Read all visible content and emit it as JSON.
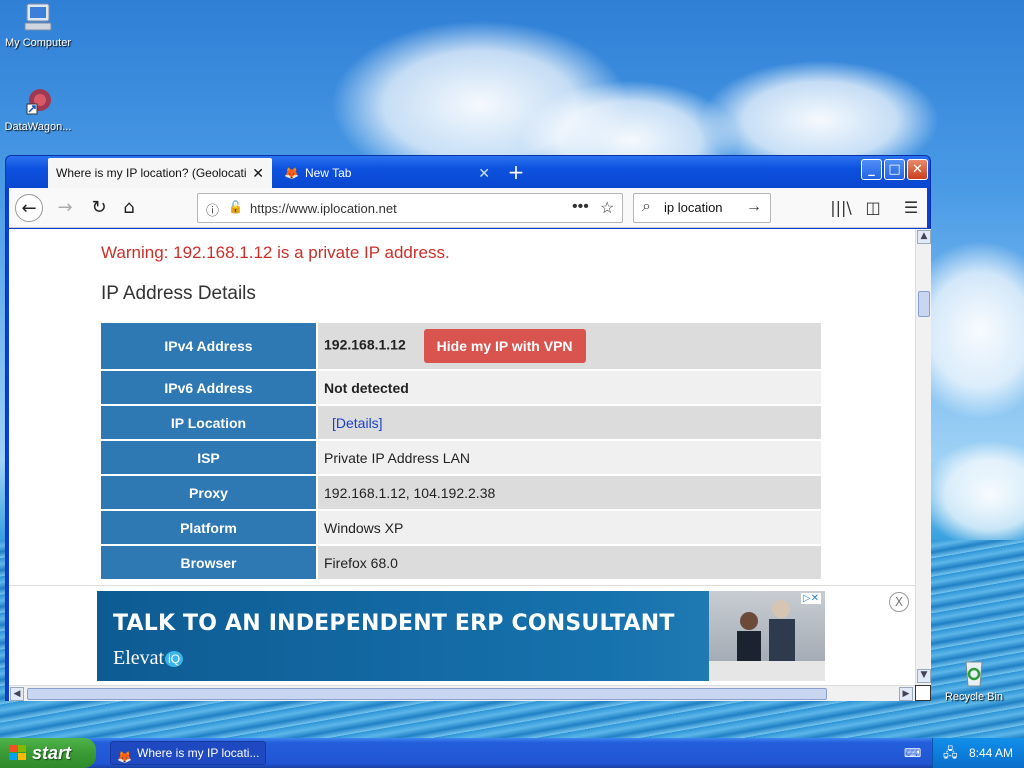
{
  "desktop": {
    "icons": [
      {
        "label": "My Computer"
      },
      {
        "label": "DataWagon..."
      },
      {
        "label": "Recycle Bin"
      }
    ]
  },
  "browser": {
    "tabs": [
      {
        "title": "Where is my IP location? (Geolocation)",
        "active": true
      },
      {
        "title": "New Tab",
        "active": false
      }
    ],
    "new_tab_symbol": "+",
    "url": "https://www.iplocation.net",
    "search_value": "ip location"
  },
  "page": {
    "warning": "Warning: 192.168.1.12 is a private IP address.",
    "section_title": "IP Address Details",
    "rows": [
      {
        "label": "IPv4 Address",
        "value": "192.168.1.12",
        "button": "Hide my IP with VPN"
      },
      {
        "label": "IPv6 Address",
        "value": "Not detected"
      },
      {
        "label": "IP Location",
        "value": "[Details]"
      },
      {
        "label": "ISP",
        "value": "Private IP Address LAN"
      },
      {
        "label": "Proxy",
        "value": "192.168.1.12, 104.192.2.38"
      },
      {
        "label": "Platform",
        "value": "Windows XP"
      },
      {
        "label": "Browser",
        "value": "Firefox 68.0"
      }
    ]
  },
  "ad": {
    "headline": "TALK TO AN INDEPENDENT ERP CONSULTANT",
    "brand": "Elevat",
    "brand_badge": "iQ",
    "close_symbol": "X"
  },
  "taskbar": {
    "start_label": "start",
    "task_title": "Where is my IP locati...",
    "clock": "8:44 AM"
  },
  "colors": {
    "warning": "#cc2f2a",
    "table_header": "#2e78b4",
    "vpn_button": "#d9534f",
    "link": "#1a3fcf"
  }
}
